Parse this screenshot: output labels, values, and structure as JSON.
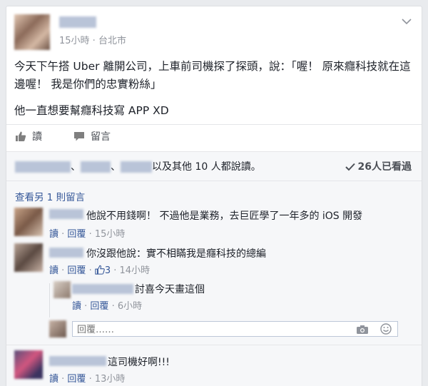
{
  "post": {
    "time_location": "15小時 · 台北市",
    "paragraph1": "今天下午搭 Uber 離開公司，上車前司機探了探頭，說：「喔！ 原來癮科技就在這邊喔！ 我是你們的忠實粉絲」",
    "paragraph2": "他一直想要幫癮科技寫 APP XD"
  },
  "actions": {
    "like": "讀",
    "comment": "留言"
  },
  "likes": {
    "sep1": "、",
    "sep2": "、",
    "tail": "以及其他 10 人都說讀。",
    "seen": "26人已看過"
  },
  "more_comments": "查看另 1 則留言",
  "comments": [
    {
      "text": "他說不用錢啊！ 不過他是業務，去巨匠學了一年多的 iOS 開發",
      "like": "讀",
      "reply": "回覆",
      "time": "15小時",
      "dot": " · "
    },
    {
      "text": "你沒跟他說：實不相瞞我是癮科技的總編",
      "like": "讀",
      "reply": "回覆",
      "likes_count": "3",
      "time": "14小時",
      "dot": " · "
    },
    {
      "text": "討喜今天畫這個",
      "like": "讀",
      "reply": "回覆",
      "time": "6小時",
      "dot": " · "
    },
    {
      "text": "這司機好啊!!!",
      "like": "讀",
      "reply": "回覆",
      "time": "13小時",
      "dot": " · "
    }
  ],
  "reply_input": {
    "placeholder": "回覆……"
  },
  "icons": {
    "chevron": "chevron-down-icon",
    "like": "thumbs-up-icon",
    "comment": "speech-bubble-icon",
    "seen": "checkmark-icon",
    "camera": "camera-icon",
    "emoji": "smiley-icon"
  },
  "colors": {
    "link": "#365899",
    "meta": "#90949c",
    "background": "#e9ebee"
  }
}
